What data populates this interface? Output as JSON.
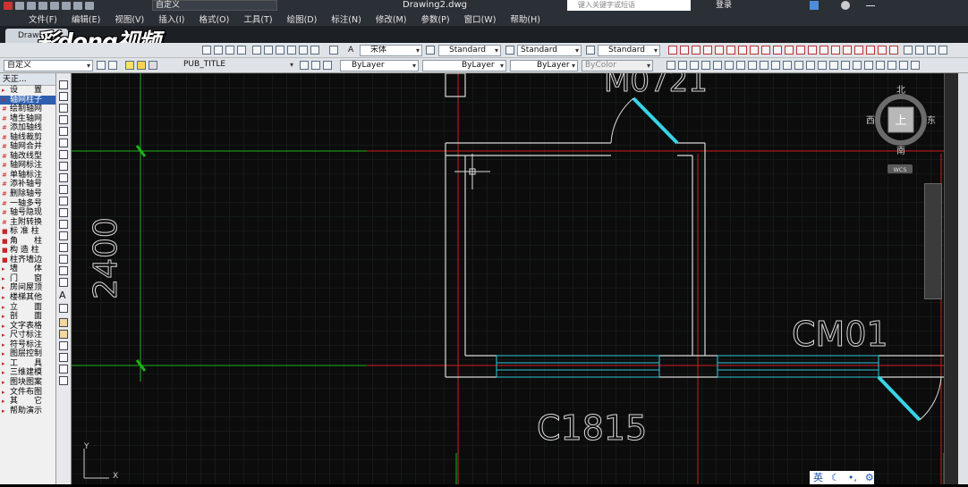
{
  "titlebar": {
    "workspace": "自定义",
    "document_title": "Drawing2.dwg",
    "search_placeholder": "键入关键字或短语",
    "login_label": "登录"
  },
  "menu": [
    "文件(F)",
    "编辑(E)",
    "视图(V)",
    "插入(I)",
    "格式(O)",
    "工具(T)",
    "绘图(D)",
    "标注(N)",
    "修改(M)",
    "参数(P)",
    "窗口(W)",
    "帮助(H)"
  ],
  "file_tab": "Drawi",
  "watermark_logo": "彩dong视频",
  "toolbar1": {
    "text_style_font": "宋体",
    "text_style": "Standard",
    "dim_style": "Standard",
    "table_style": "Standard"
  },
  "toolbar2": {
    "workspace": "自定义",
    "layer": "PUB_TITLE",
    "color": "ByLayer",
    "linetype": "ByLayer",
    "lineweight": "ByLayer",
    "plotstyle": "ByColor"
  },
  "left_panel": {
    "title": "天正...",
    "items": [
      {
        "icon": "▸",
        "label": "设　　置",
        "hl": false
      },
      {
        "icon": "▾",
        "label": "轴网柱子",
        "hl": true
      },
      {
        "icon": "#",
        "label": "绘制轴网",
        "hl": false
      },
      {
        "icon": "#",
        "label": "墙生轴网",
        "hl": false
      },
      {
        "icon": "#",
        "label": "添加轴线",
        "hl": false
      },
      {
        "icon": "#",
        "label": "轴线裁剪",
        "hl": false
      },
      {
        "icon": "#",
        "label": "轴网合并",
        "hl": false
      },
      {
        "icon": "#",
        "label": "轴改线型",
        "hl": false
      },
      {
        "icon": "#",
        "label": "轴网标注",
        "hl": false
      },
      {
        "icon": "#",
        "label": "单轴标注",
        "hl": false
      },
      {
        "icon": "#",
        "label": "添补轴号",
        "hl": false
      },
      {
        "icon": "#",
        "label": "删除轴号",
        "hl": false
      },
      {
        "icon": "#",
        "label": "一轴多号",
        "hl": false
      },
      {
        "icon": "#",
        "label": "轴号隐现",
        "hl": false
      },
      {
        "icon": "#",
        "label": "主附转换",
        "hl": false
      },
      {
        "icon": "■",
        "label": "标 准 柱",
        "hl": false
      },
      {
        "icon": "■",
        "label": "角　　柱",
        "hl": false
      },
      {
        "icon": "■",
        "label": "构 造 柱",
        "hl": false
      },
      {
        "icon": "■",
        "label": "柱齐墙边",
        "hl": false
      },
      {
        "icon": "▸",
        "label": "墙　　体",
        "hl": false
      },
      {
        "icon": "▸",
        "label": "门　　窗",
        "hl": false
      },
      {
        "icon": "▸",
        "label": "房间屋顶",
        "hl": false
      },
      {
        "icon": "▸",
        "label": "楼梯其他",
        "hl": false
      },
      {
        "icon": "▸",
        "label": "立　　面",
        "hl": false
      },
      {
        "icon": "▸",
        "label": "剖　　面",
        "hl": false
      },
      {
        "icon": "▸",
        "label": "文字表格",
        "hl": false
      },
      {
        "icon": "▸",
        "label": "尺寸标注",
        "hl": false
      },
      {
        "icon": "▸",
        "label": "符号标注",
        "hl": false
      },
      {
        "icon": "▸",
        "label": "图层控制",
        "hl": false
      },
      {
        "icon": "▸",
        "label": "工　　具",
        "hl": false
      },
      {
        "icon": "▸",
        "label": "三维建模",
        "hl": false
      },
      {
        "icon": "▸",
        "label": "图块图案",
        "hl": false
      },
      {
        "icon": "▸",
        "label": "文件布图",
        "hl": false
      },
      {
        "icon": "▸",
        "label": "其　　它",
        "hl": false
      },
      {
        "icon": "▸",
        "label": "帮助演示",
        "hl": false
      }
    ]
  },
  "drawing": {
    "dimension_text": "2400",
    "labels": {
      "door_top": "M0721",
      "window_right": "CM01",
      "window_bottom": "C1815"
    },
    "colors": {
      "axis": "#d21e1e",
      "wall": "#d9d9d9",
      "window": "#2ec7d8",
      "dimension": "#19b319",
      "door_leaf": "#37d4e6"
    }
  },
  "viewcube": {
    "north": "北",
    "south": "南",
    "east": "东",
    "west": "西",
    "top": "上",
    "wcs": "WCS"
  },
  "ucs": {
    "x": "X",
    "y": "Y"
  },
  "ime": {
    "lang": "英"
  }
}
